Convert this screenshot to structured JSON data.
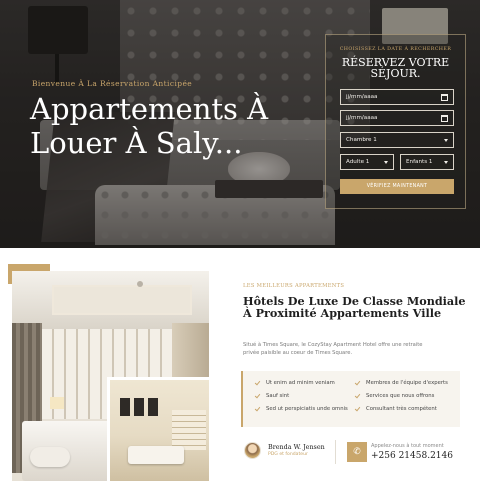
{
  "hero": {
    "welcome": "Bienvenue À La Réservation Anticipée",
    "title": "Appartements À Louer À Saly..."
  },
  "booking": {
    "kicker": "CHOISISSEZ LA DATE À RECHERCHER",
    "title": "RÉSERVEZ VOTRE SÉJOUR.",
    "checkin_placeholder": "jj/mm/aaaa",
    "checkout_placeholder": "jj/mm/aaaa",
    "room_value": "Chambre 1",
    "adults_value": "Adulte 1",
    "children_value": "Enfants 1",
    "submit_label": "VÉRIFIEZ MAINTENANT"
  },
  "about": {
    "eyebrow": "LES MEILLEURS APPARTEMENTS",
    "heading": "Hôtels De Luxe De Classe Mondiale À Proximité Appartements Ville",
    "description": "Situé à Times Square, le CozyStay Apartment Hotel offre une retraite privée paisible au coeur de Times Square.",
    "features": [
      "Ut enim ad minim veniam",
      "Membres de l'équipe d'experts",
      "Sauf sint",
      "Services que nous offrons",
      "Sed ut perspiciatis unde omnis",
      "Consultant très compétent"
    ],
    "person_name": "Brenda W. Jensen",
    "person_role": "PDG et fondateur",
    "call_label": "Appelez-nous à tout moment",
    "call_number": "+256 21458.2146"
  },
  "colors": {
    "accent": "#c9a66b",
    "dark": "#2d2b2a",
    "feature_bg": "#f7f4ee"
  },
  "icons": [
    "calendar-icon",
    "chevron-down-icon",
    "check-icon",
    "phone-icon"
  ]
}
